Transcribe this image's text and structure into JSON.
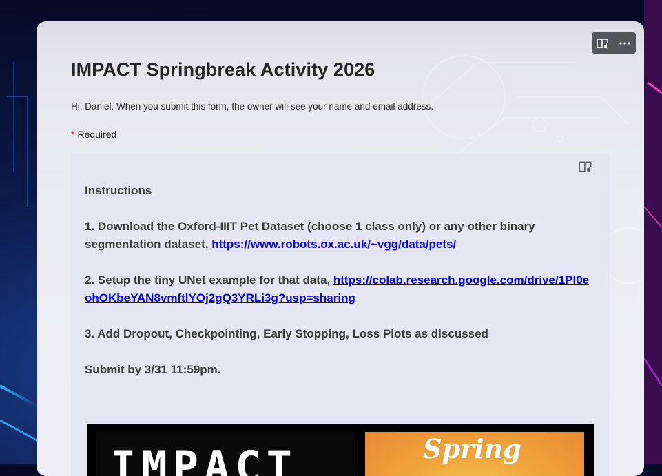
{
  "form": {
    "title": "IMPACT Springbreak Activity 2026",
    "notice": "Hi, Daniel. When you submit this form, the owner will see your name and email address.",
    "required_star": "*",
    "required_label": "Required"
  },
  "toolbar": {
    "icons": [
      "immersive-reader-icon",
      "more-options-icon"
    ]
  },
  "section": {
    "heading": "Instructions",
    "step1_text": "1. Download the Oxford-IIIT Pet Dataset (choose 1 class only) or any other binary segmentation dataset, ",
    "step1_link": "https://www.robots.ox.ac.uk/~vgg/data/pets/",
    "step2_text": "2. Setup the tiny UNet example for that data, ",
    "step2_link": "https://colab.research.google.com/drive/1Pl0eohOKbeYAN8vmftlYOj2gQ3YRLi3g?usp=sharing",
    "step3_text": "3. Add Dropout, Checkpointing, Early Stopping, Loss Plots as discussed",
    "deadline": "Submit by 3/31 11:59pm.",
    "banner_left_text": "IMPACT",
    "banner_right_text": "Spring"
  },
  "colors": {
    "link": "#0000ee",
    "required_star": "#c4314b",
    "toolbar_bg": "#55555d"
  }
}
